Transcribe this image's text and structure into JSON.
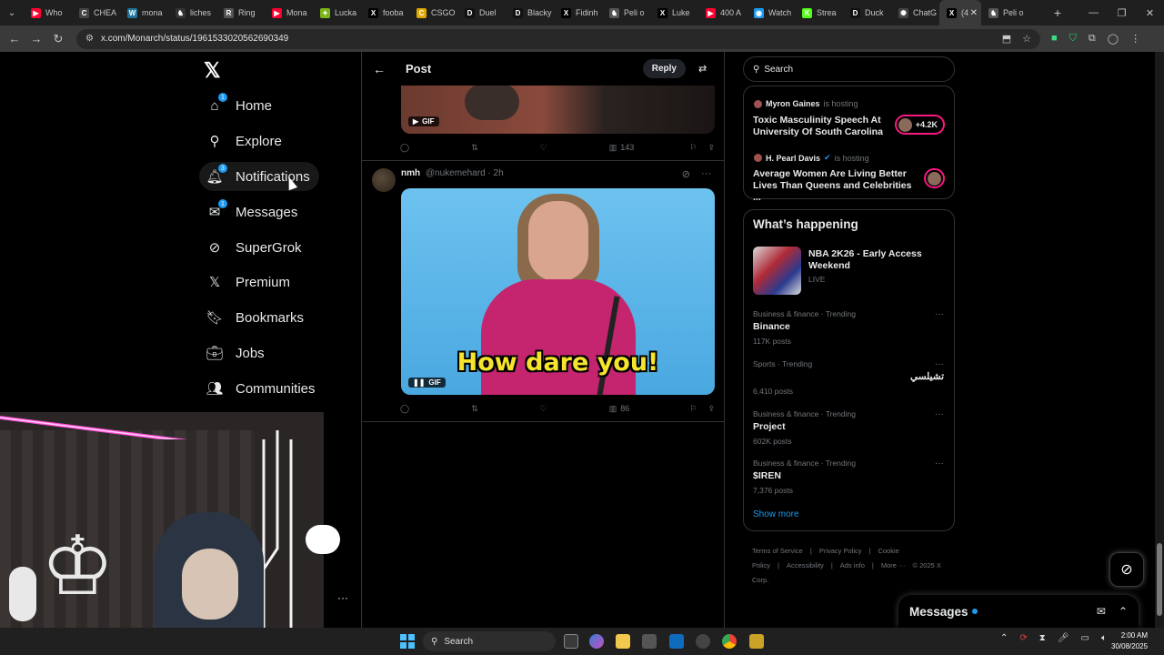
{
  "browser": {
    "tabs": [
      {
        "label": "Who",
        "color": "#ff0033",
        "glyph": "▶"
      },
      {
        "label": "CHEA",
        "color": "#444",
        "glyph": "C"
      },
      {
        "label": "mona",
        "color": "#21759b",
        "glyph": "W"
      },
      {
        "label": "liches",
        "color": "#333",
        "glyph": "♞"
      },
      {
        "label": "Ring",
        "color": "#555",
        "glyph": "R"
      },
      {
        "label": "Mona",
        "color": "#ff0033",
        "glyph": "▶"
      },
      {
        "label": "Lucka",
        "color": "#7cb518",
        "glyph": "✦"
      },
      {
        "label": "fooba",
        "color": "#000",
        "glyph": "X"
      },
      {
        "label": "CSGO",
        "color": "#e0a800",
        "glyph": "C"
      },
      {
        "label": "Duel",
        "color": "#111",
        "glyph": "D"
      },
      {
        "label": "Blacky",
        "color": "#111",
        "glyph": "D"
      },
      {
        "label": "Fidinh",
        "color": "#000",
        "glyph": "X"
      },
      {
        "label": "Peli o",
        "color": "#555",
        "glyph": "♞"
      },
      {
        "label": "Luke",
        "color": "#000",
        "glyph": "X"
      },
      {
        "label": "400 A",
        "color": "#ff0033",
        "glyph": "▶"
      },
      {
        "label": "Watch",
        "color": "#1d9bf0",
        "glyph": "◉"
      },
      {
        "label": "Strea",
        "color": "#53fc18",
        "glyph": "K"
      },
      {
        "label": "Duck",
        "color": "#111",
        "glyph": "D"
      },
      {
        "label": "ChatG",
        "color": "#444",
        "glyph": "✺"
      },
      {
        "label": "(4",
        "color": "#000",
        "glyph": "X",
        "active": true
      },
      {
        "label": "Peli o",
        "color": "#555",
        "glyph": "♞"
      }
    ],
    "url": "x.com/Monarch/status/1961533020562690349"
  },
  "nav": {
    "items": [
      {
        "label": "Home",
        "icon": "home-icon",
        "glyph": "⌂",
        "badge": "1"
      },
      {
        "label": "Explore",
        "icon": "search-icon",
        "glyph": "⚲"
      },
      {
        "label": "Notifications",
        "icon": "bell-icon",
        "glyph": "🔔︎",
        "badge": "3"
      },
      {
        "label": "Messages",
        "icon": "envelope-icon",
        "glyph": "✉",
        "badge": "1"
      },
      {
        "label": "SuperGrok",
        "icon": "grok-icon",
        "glyph": "⊘"
      },
      {
        "label": "Premium",
        "icon": "x-logo-icon",
        "glyph": "𝕏"
      },
      {
        "label": "Bookmarks",
        "icon": "bookmark-icon",
        "glyph": "🔖︎"
      },
      {
        "label": "Jobs",
        "icon": "briefcase-icon",
        "glyph": "💼︎"
      },
      {
        "label": "Communities",
        "icon": "people-icon",
        "glyph": "👥︎"
      }
    ]
  },
  "post_header": {
    "title": "Post",
    "reply_label": "Reply"
  },
  "posts": [
    {
      "gif_label": "GIF",
      "views": "143"
    },
    {
      "display_name": "nmh",
      "handle": "@nukemehard",
      "time": "· 2h",
      "caption": "How dare you!",
      "gif_label": "GIF",
      "views": "86"
    }
  ],
  "right": {
    "search_placeholder": "Search",
    "spaces": [
      {
        "host": "Myron Gaines",
        "status": "is hosting",
        "title": "Toxic Masculinity Speech At University Of South Carolina",
        "listeners": "+4.2K"
      },
      {
        "host": "H. Pearl Davis",
        "status": "is hosting",
        "title": "Average Women Are Living Better Lives Than Queens and Celebrities ...",
        "listeners": ""
      }
    ],
    "whats_happening": {
      "title": "What’s happening",
      "featured": {
        "name": "NBA 2K26 - Early Access Weekend",
        "status": "LIVE"
      },
      "trends": [
        {
          "category": "Business & finance · Trending",
          "name": "Binance",
          "count": "117K posts"
        },
        {
          "category": "Sports · Trending",
          "name": "تشيلسي",
          "count": "6,410 posts"
        },
        {
          "category": "Business & finance · Trending",
          "name": "Project",
          "count": "602K posts"
        },
        {
          "category": "Business & finance · Trending",
          "name": "$IREN",
          "count": "7,376 posts"
        }
      ],
      "show_more": "Show more"
    },
    "footer": [
      "Terms of Service",
      "|",
      "Privacy Policy",
      "|",
      "Cookie Policy",
      "|",
      "Accessibility",
      "|",
      "Ads info",
      "|",
      "More ···",
      "© 2025 X Corp."
    ]
  },
  "messages_drawer": {
    "title": "Messages"
  },
  "taskbar": {
    "search_label": "Search",
    "time": "2:00 AM",
    "date": "30/08/2025"
  }
}
